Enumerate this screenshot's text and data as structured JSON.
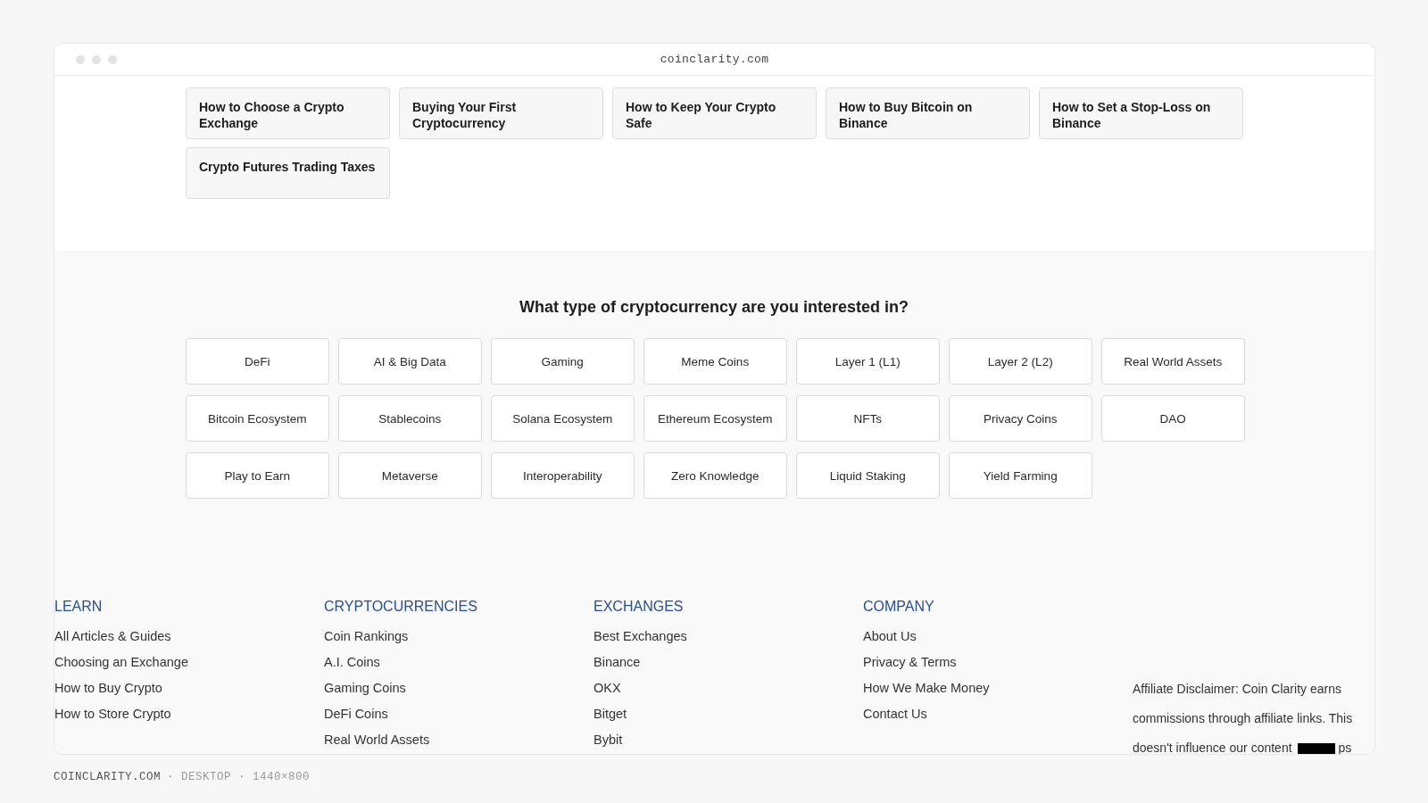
{
  "browser": {
    "address": "coinclarity.com"
  },
  "guides": [
    "How to Choose a Crypto Exchange",
    "Buying Your First Cryptocurrency",
    "How to Keep Your Crypto Safe",
    "How to Buy Bitcoin on Binance",
    "How to Set a Stop-Loss on Binance",
    "Crypto Futures Trading Taxes"
  ],
  "categories": {
    "title": "What type of cryptocurrency are you interested in?",
    "items": [
      "DeFi",
      "AI & Big Data",
      "Gaming",
      "Meme Coins",
      "Layer 1 (L1)",
      "Layer 2 (L2)",
      "Real World Assets",
      "Bitcoin Ecosystem",
      "Stablecoins",
      "Solana Ecosystem",
      "Ethereum Ecosystem",
      "NFTs",
      "Privacy Coins",
      "DAO",
      "Play to Earn",
      "Metaverse",
      "Interoperability",
      "Zero Knowledge",
      "Liquid Staking",
      "Yield Farming"
    ]
  },
  "footer": {
    "columns": [
      {
        "heading": "LEARN",
        "links": [
          "All Articles & Guides",
          "Choosing an Exchange",
          "How to Buy Crypto",
          "How to Store Crypto"
        ]
      },
      {
        "heading": "CRYPTOCURRENCIES",
        "links": [
          "Coin Rankings",
          "A.I. Coins",
          "Gaming Coins",
          "DeFi Coins",
          "Real World Assets"
        ]
      },
      {
        "heading": "EXCHANGES",
        "links": [
          "Best Exchanges",
          "Binance",
          "OKX",
          "Bitget",
          "Bybit"
        ]
      },
      {
        "heading": "COMPANY",
        "links": [
          "About Us",
          "Privacy & Terms",
          "How We Make Money",
          "Contact Us"
        ]
      }
    ],
    "disclaimer": {
      "text": "Affiliate Disclaimer: Coin Clarity earns commissions through affiliate links. This",
      "last_line": "doesn't influence our content",
      "tail": "ps"
    }
  },
  "caption": {
    "site": "COINCLARITY.COM",
    "details": "· DESKTOP · 1440×800"
  }
}
